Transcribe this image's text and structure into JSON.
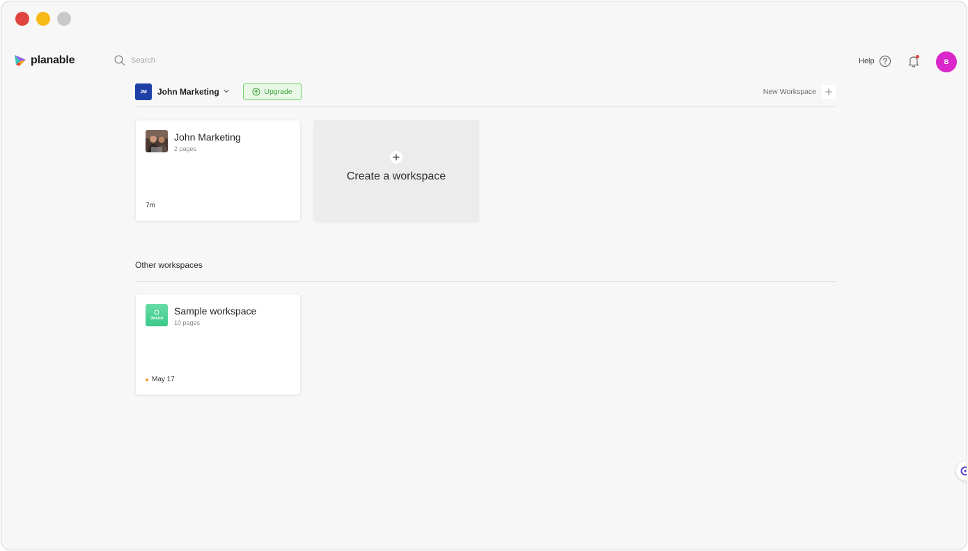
{
  "app": {
    "logo_text": "planable",
    "search_placeholder": "Search"
  },
  "topbar": {
    "help_label": "Help",
    "avatar_initial": "B",
    "avatar_color": "#d927c9",
    "notification_indicator": true
  },
  "workspace_header": {
    "badge": "JM",
    "badge_color": "#1d3fa6",
    "name": "John Marketing",
    "upgrade_label": "Upgrade",
    "new_workspace_label": "New Workspace"
  },
  "my_workspaces": [
    {
      "title": "John Marketing",
      "subtitle": "2 pages",
      "footer": "7m",
      "thumbnail": "photo"
    }
  ],
  "create_card": {
    "label": "Create a workspace"
  },
  "other_section": {
    "title": "Other workspaces"
  },
  "other_workspaces": [
    {
      "title": "Sample workspace",
      "subtitle": "10 pages",
      "footer": "May 17",
      "thumbnail_text": "Jusco",
      "thumbnail_color": "#4fd39a",
      "status_dot_color": "#f39a3b"
    }
  ],
  "colors": {
    "upgrade_green": "#3aa537",
    "background": "#f7f7f7"
  }
}
